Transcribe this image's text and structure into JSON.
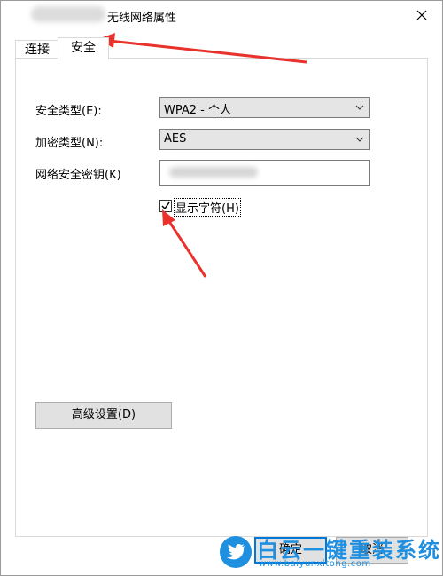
{
  "window": {
    "title": "无线网络属性"
  },
  "tabs": [
    {
      "label": "连接",
      "active": false
    },
    {
      "label": "安全",
      "active": true
    }
  ],
  "security": {
    "security_type_label": "安全类型(E):",
    "security_type_value": "WPA2 - 个人",
    "encryption_type_label": "加密类型(N):",
    "encryption_type_value": "AES",
    "network_key_label": "网络安全密钥(K)",
    "show_chars_label": "显示字符(H)",
    "show_chars_checked": true
  },
  "buttons": {
    "advanced": "高级设置(D)",
    "ok": "确定",
    "cancel": "取消"
  },
  "watermark": {
    "title": "白云一键重装系统",
    "url": "www.baiyunxitong.com"
  },
  "colors": {
    "accent": "#0078d7",
    "annotation_arrow": "#e8322b",
    "watermark": "#1f8fe0"
  },
  "icons": {
    "close": "close-icon",
    "dropdown": "chevron-down-icon",
    "check": "checkmark-icon",
    "watermark_logo": "twitter-bird-icon"
  }
}
